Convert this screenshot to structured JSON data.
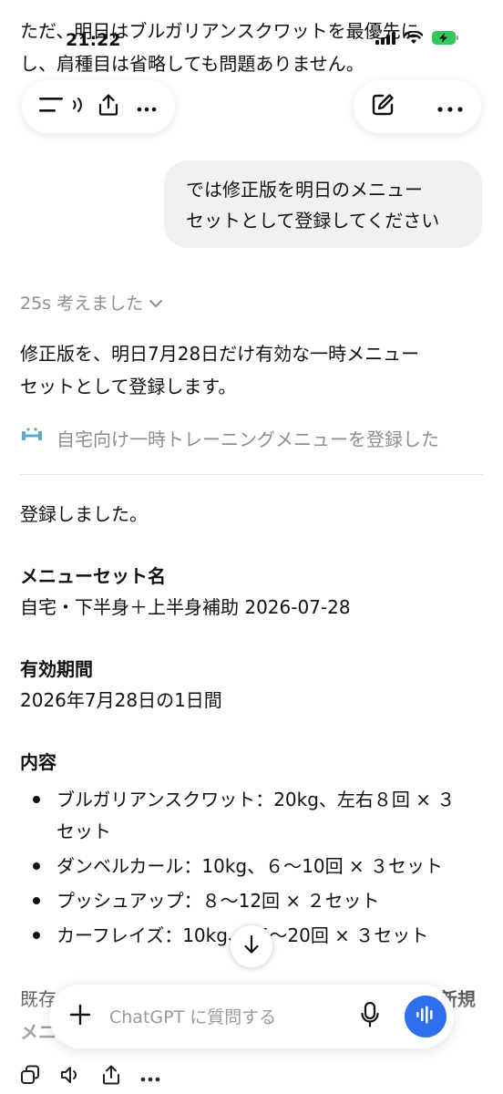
{
  "status_bar": {
    "time": "21:22"
  },
  "prev_message": {
    "line1": "ただ、明日はブルガリアンスクワットを最優先に",
    "line2": "し、肩種目は省略しても問題ありません。"
  },
  "user_message": {
    "line1": "では修正版を明日のメニュー",
    "line2": "セットとして登録してください"
  },
  "thought": {
    "label": "25s 考えました"
  },
  "assistant": {
    "intro_line1": "修正版を、明日7月28日だけ有効な一時メニュー",
    "intro_line2": "セットとして登録します。",
    "tool_call": "自宅向け一時トレーニングメニューを登録した",
    "registered": "登録しました。",
    "set_name_heading": "メニューセット名",
    "set_name_value": "自宅・下半身＋上半身補助 2026-07-28",
    "period_heading": "有効期間",
    "period_value": "2026年7月28日の1日間",
    "content_heading": "内容",
    "items": [
      {
        "line1": "ブルガリアンスクワット：20kg、左右８回 × ３",
        "line2": "セット"
      },
      {
        "line1": "ダンベルカール：10kg、６〜10回 × ３セット"
      },
      {
        "line1": "プッシュアップ：８〜12回 × ２セット"
      },
      {
        "line1": "カーフレイズ：10kg、15〜20回 × ３セット"
      }
    ],
    "trailing_line1": "既存",
    "trailing_line1_end": "新規",
    "trailing_line2": "メニ"
  },
  "composer": {
    "placeholder": "ChatGPT に質問する"
  },
  "colors": {
    "voice_button": "#2f6fee",
    "bubble": "#f1f1f1",
    "muted_text": "#8e8e8e"
  }
}
